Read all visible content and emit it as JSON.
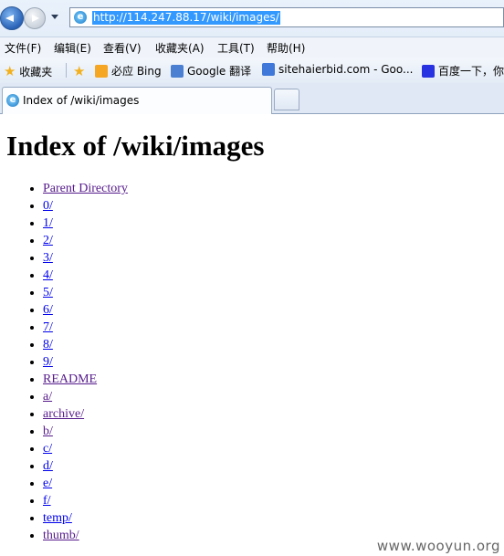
{
  "browser": {
    "address_url": "http://114.247.88.17/wiki/images/",
    "menu": [
      "文件(F)",
      "编辑(E)",
      "查看(V)",
      "收藏夹(A)",
      "工具(T)",
      "帮助(H)"
    ],
    "favorites_label": "收藏夹",
    "favorites": [
      "必应 Bing",
      "Google 翻译",
      "sitehaierbid.com - Goo...",
      "百度一下，你"
    ],
    "tab_title": "Index of /wiki/images"
  },
  "page": {
    "heading": "Index of /wiki/images",
    "links": [
      {
        "text": "Parent Directory",
        "visited": true
      },
      {
        "text": "0/",
        "visited": false
      },
      {
        "text": "1/",
        "visited": false
      },
      {
        "text": "2/",
        "visited": false
      },
      {
        "text": "3/",
        "visited": false
      },
      {
        "text": "4/",
        "visited": false
      },
      {
        "text": "5/",
        "visited": false
      },
      {
        "text": "6/",
        "visited": false
      },
      {
        "text": "7/",
        "visited": false
      },
      {
        "text": "8/",
        "visited": false
      },
      {
        "text": "9/",
        "visited": false
      },
      {
        "text": "README",
        "visited": true
      },
      {
        "text": "a/",
        "visited": true
      },
      {
        "text": "archive/",
        "visited": true
      },
      {
        "text": "b/",
        "visited": true
      },
      {
        "text": "c/",
        "visited": false
      },
      {
        "text": "d/",
        "visited": false
      },
      {
        "text": "e/",
        "visited": false
      },
      {
        "text": "f/",
        "visited": false
      },
      {
        "text": "temp/",
        "visited": false
      },
      {
        "text": "thumb/",
        "visited": true
      }
    ]
  },
  "watermark": "www.wooyun.org"
}
